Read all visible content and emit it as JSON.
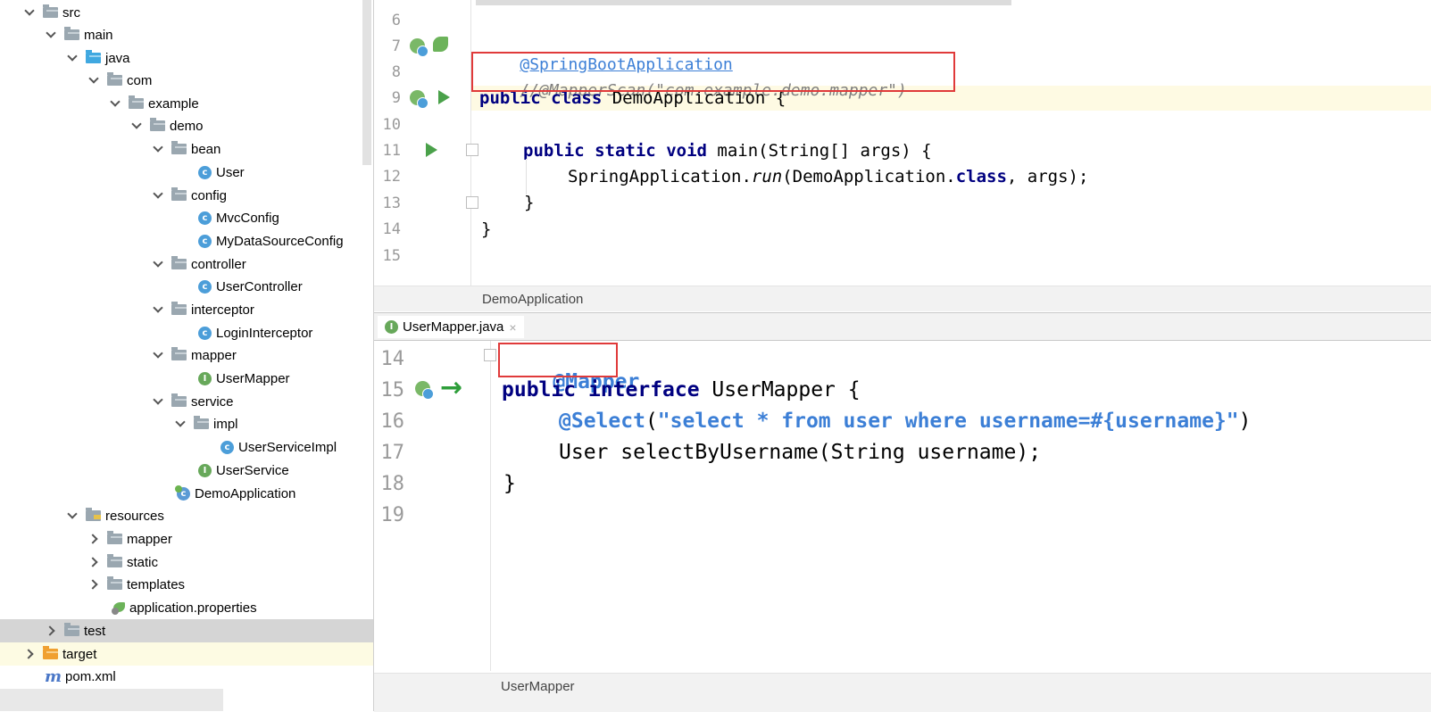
{
  "tree": {
    "src": "src",
    "main": "main",
    "java": "java",
    "com": "com",
    "example": "example",
    "demo": "demo",
    "bean": "bean",
    "user": "User",
    "config": "config",
    "mvcconfig": "MvcConfig",
    "mydatasourceconfig": "MyDataSourceConfig",
    "controller": "controller",
    "usercontroller": "UserController",
    "interceptor": "interceptor",
    "logininterceptor": "LoginInterceptor",
    "mapper": "mapper",
    "usermapper": "UserMapper",
    "service": "service",
    "impl": "impl",
    "userserviceimpl": "UserServiceImpl",
    "userservice": "UserService",
    "demoapplication": "DemoApplication",
    "resources": "resources",
    "res_mapper": "mapper",
    "static": "static",
    "templates": "templates",
    "appprops": "application.properties",
    "test": "test",
    "target": "target",
    "pom": "pom.xml"
  },
  "editor1": {
    "lines": [
      "6",
      "7",
      "8",
      "9",
      "10",
      "11",
      "12",
      "13",
      "14",
      "15"
    ],
    "annotation": "@SpringBootApplication",
    "comment": "//@MapperScan(\"com.example.demo.mapper\")",
    "kw_public": "public",
    "kw_class": "class",
    "class_name": " DemoApplication {",
    "kw_static": "static",
    "kw_void": "void",
    "main_sig": " main(String[] args) {",
    "run_prefix": "SpringApplication.",
    "run_method": "run",
    "run_mid": "(DemoApplication.",
    "run_class_kw": "class",
    "run_suffix": ", args);",
    "close_inner": "}",
    "close_outer": "}",
    "breadcrumb": "DemoApplication"
  },
  "tab": {
    "label": "UserMapper.java",
    "close": "×"
  },
  "editor2": {
    "lines": [
      "14",
      "15",
      "16",
      "17",
      "18",
      "19"
    ],
    "mapper_annotation": "@Mapper",
    "kw_public": "public",
    "kw_interface": "interface",
    "iface_name": " UserMapper {",
    "select_annotation": "@Select",
    "select_open": "(",
    "select_string": "\"select * from user where username=#{username}\"",
    "select_close": ")",
    "method_line": "User selectByUsername(String username);",
    "close": "}",
    "breadcrumb": "UserMapper"
  }
}
